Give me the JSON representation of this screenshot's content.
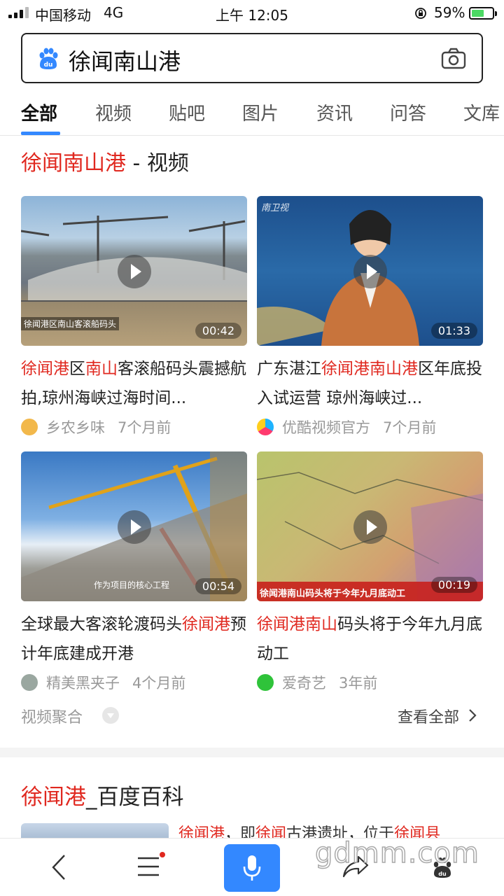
{
  "status_bar": {
    "carrier": "中国移动",
    "network": "4G",
    "time": "上午 12:05",
    "battery_percent": "59%",
    "battery_level": 0.59
  },
  "search": {
    "query": "徐闻南山港",
    "icons": {
      "left": "baidu-paw-icon",
      "right": "camera-icon"
    }
  },
  "tabs": [
    "全部",
    "视频",
    "贴吧",
    "图片",
    "资讯",
    "问答",
    "文库"
  ],
  "video_section": {
    "title_highlight": "徐闻南山港",
    "title_rest": " - 视频",
    "videos": [
      {
        "title_parts": [
          {
            "text": "徐闻港",
            "hl": true
          },
          {
            "text": "区",
            "hl": false
          },
          {
            "text": "南山",
            "hl": true
          },
          {
            "text": "客滚船码头震撼航拍,琼州海峡过海时间...",
            "hl": false
          }
        ],
        "source": "乡农乡味",
        "time": "7个月前",
        "duration": "00:42",
        "overlay_text": "徐闻港区南山客滚船码头"
      },
      {
        "title_parts": [
          {
            "text": "广东湛江",
            "hl": false
          },
          {
            "text": "徐闻港南山港",
            "hl": true
          },
          {
            "text": "区年底投入试运营 琼州海峡过...",
            "hl": false
          }
        ],
        "source": "优酷视频官方",
        "time": "7个月前",
        "duration": "01:33",
        "overlay_text": "南卫视"
      },
      {
        "title_parts": [
          {
            "text": "全球最大客滚轮渡码头",
            "hl": false
          },
          {
            "text": "徐闻港",
            "hl": true
          },
          {
            "text": "预计年底建成开港",
            "hl": false
          }
        ],
        "source": "精美黑夹子",
        "time": "4个月前",
        "duration": "00:54",
        "overlay_text": "作为项目的核心工程"
      },
      {
        "title_parts": [
          {
            "text": "徐闻港南山",
            "hl": true
          },
          {
            "text": "码头将于今年九月底动工",
            "hl": false
          }
        ],
        "source": "爱奇艺",
        "time": "3年前",
        "duration": "00:19",
        "overlay_text": "徐闻港南山码头将于今年九月底动工"
      }
    ],
    "aggregate_label": "视频聚合",
    "view_all_label": "查看全部"
  },
  "baike": {
    "title_highlight": "徐闻港",
    "title_rest": "_百度百科",
    "snippet_parts": [
      {
        "text": "徐闻港",
        "hl": true
      },
      {
        "text": "，即",
        "hl": false
      },
      {
        "text": "徐闻",
        "hl": true
      },
      {
        "text": "古港遗址，位于",
        "hl": false
      },
      {
        "text": "徐闻县",
        "hl": true
      }
    ]
  },
  "bottom_bar": {
    "icons": [
      "back-icon",
      "menu-icon",
      "mic-icon",
      "share-icon",
      "baidu-home-icon"
    ]
  },
  "site_watermark": "gdmm.com",
  "colors": {
    "highlight": "#e0281f",
    "accent": "#3388ff"
  }
}
